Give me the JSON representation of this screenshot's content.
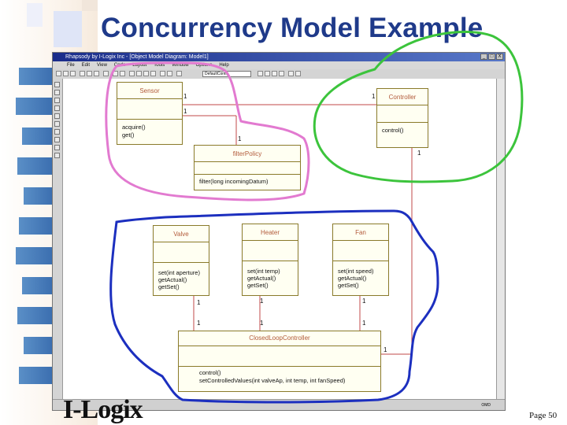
{
  "slide": {
    "title": "Concurrency Model Example",
    "page": "Page 50",
    "logo_text": "I-Logix"
  },
  "window": {
    "title": "Rhapsody by I-Logix Inc - [Object Model Diagram: Model1]",
    "buttons": [
      "_",
      "□",
      "X"
    ],
    "menu": [
      "File",
      "Edit",
      "View",
      "Code",
      "Layout",
      "Tools",
      "Window",
      "Options",
      "Help"
    ],
    "toolbar_select": "DefaultConfig",
    "status": "OMD"
  },
  "diagram": {
    "classes": {
      "sensor": {
        "name": "Sensor",
        "ops": [
          "acquire()",
          "get()"
        ]
      },
      "controller": {
        "name": "Controller",
        "ops": [
          "control()"
        ]
      },
      "filter_policy": {
        "name": "filterPolicy",
        "ops": [
          "filter(long incomingDatum)"
        ]
      },
      "valve": {
        "name": "Valve",
        "ops": [
          "set(int aperture)",
          "getActual()",
          "getSet()"
        ]
      },
      "heater": {
        "name": "Heater",
        "ops": [
          "set(int temp)",
          "getActual()",
          "getSet()"
        ]
      },
      "fan": {
        "name": "Fan",
        "ops": [
          "set(int speed)",
          "getActual()",
          "getSet()"
        ]
      },
      "closed_loop": {
        "name": "ClosedLoopController",
        "ops": [
          "control()",
          "setControlledValues(int valveAp, int temp, int fanSpeed)"
        ]
      }
    },
    "multiplicity": "1"
  },
  "colors": {
    "title": "#1f3a8a",
    "pink_scribble": "#e27ad0",
    "green_scribble": "#3cc43c",
    "blue_scribble": "#1c2fbf",
    "association": "#c24a4a"
  }
}
